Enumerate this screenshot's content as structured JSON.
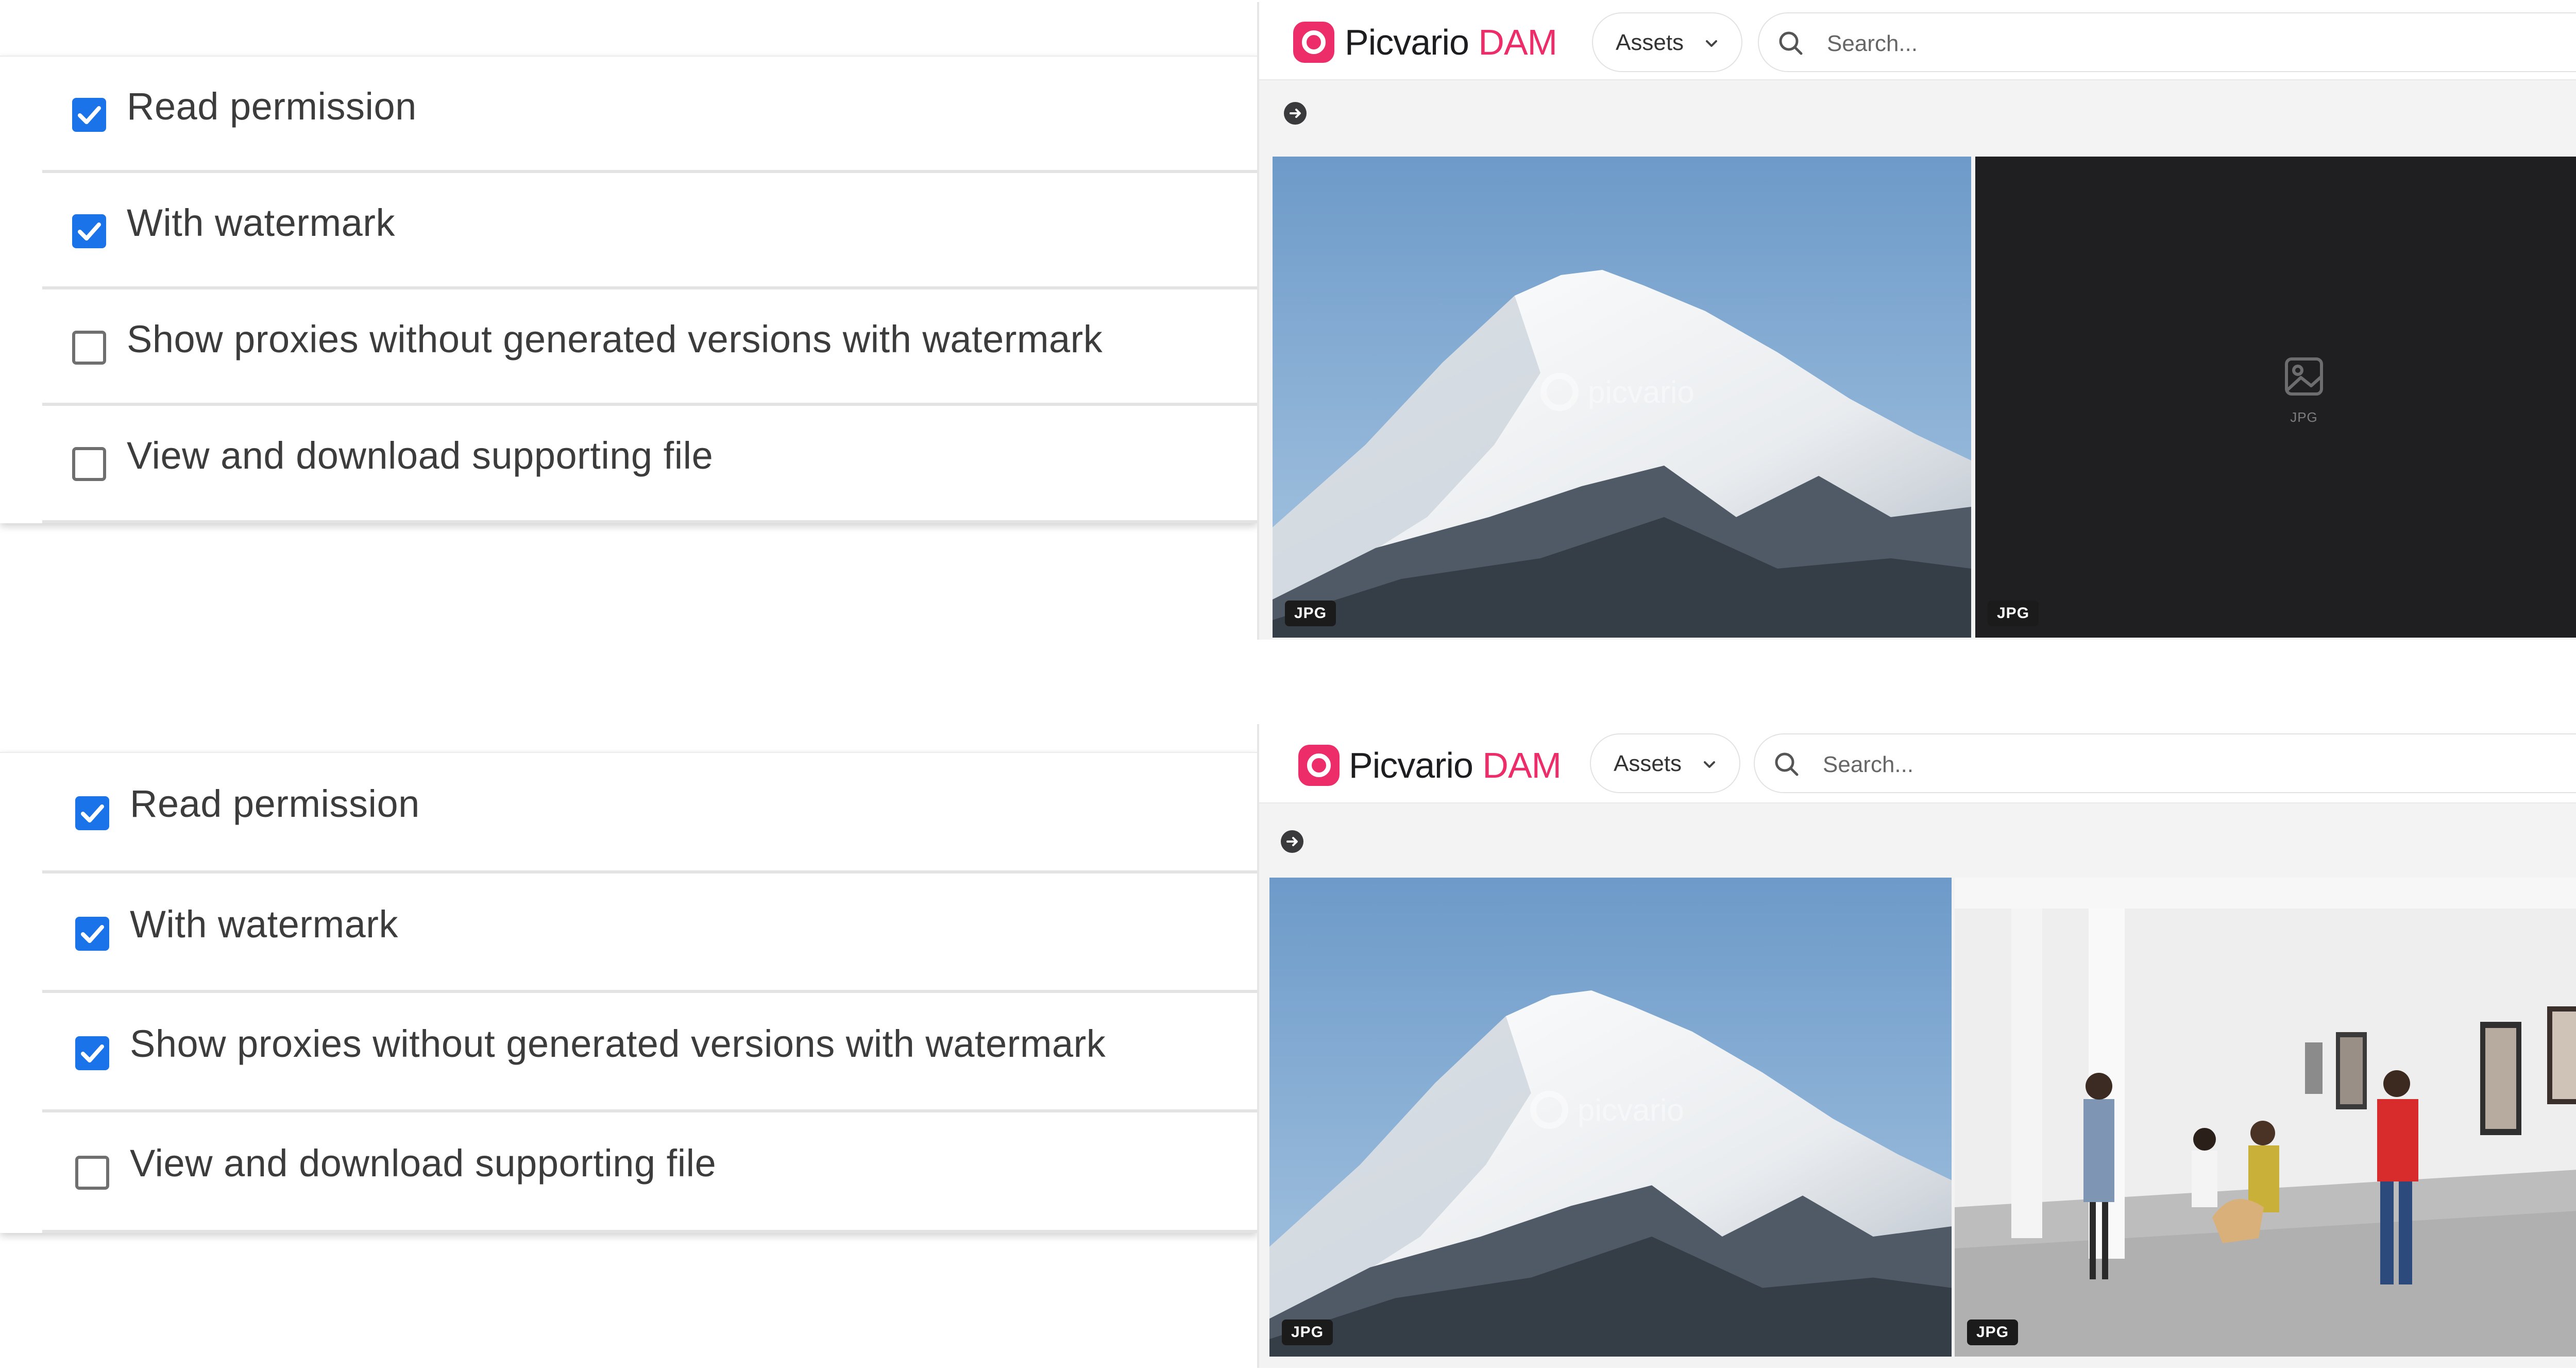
{
  "panels": [
    {
      "permissions": [
        {
          "label": "Read permission",
          "checked": true
        },
        {
          "label": "With watermark",
          "checked": true
        },
        {
          "label": "Show proxies without generated versions with watermark",
          "checked": false
        },
        {
          "label": "View and download supporting file",
          "checked": false
        }
      ],
      "dam": {
        "brand_name": "Picvario",
        "brand_suffix": "DAM",
        "assets_label": "Assets",
        "search_placeholder": "Search...",
        "tiles": [
          {
            "type": "mountain",
            "watermark": "picvario",
            "badge": "JPG"
          },
          {
            "type": "placeholder",
            "placeholder_label": "JPG",
            "badge": "JPG"
          }
        ]
      }
    },
    {
      "permissions": [
        {
          "label": "Read permission",
          "checked": true
        },
        {
          "label": "With watermark",
          "checked": true
        },
        {
          "label": "Show proxies without generated versions with watermark",
          "checked": true
        },
        {
          "label": "View and download supporting file",
          "checked": false
        }
      ],
      "dam": {
        "brand_name": "Picvario",
        "brand_suffix": "DAM",
        "assets_label": "Assets",
        "search_placeholder": "Search...",
        "tiles": [
          {
            "type": "mountain",
            "watermark": "picvario",
            "badge": "JPG"
          },
          {
            "type": "gallery",
            "badge": "JPG"
          }
        ]
      }
    }
  ],
  "colors": {
    "brand": "#ec2d6a",
    "checkbox": "#1a73e8",
    "placeholder_bg": "#1f1f21"
  },
  "icons": [
    "checkmark-icon",
    "chevron-down-icon",
    "search-icon",
    "arrow-right-circle-icon",
    "image-placeholder-icon",
    "picvario-logo-icon"
  ]
}
